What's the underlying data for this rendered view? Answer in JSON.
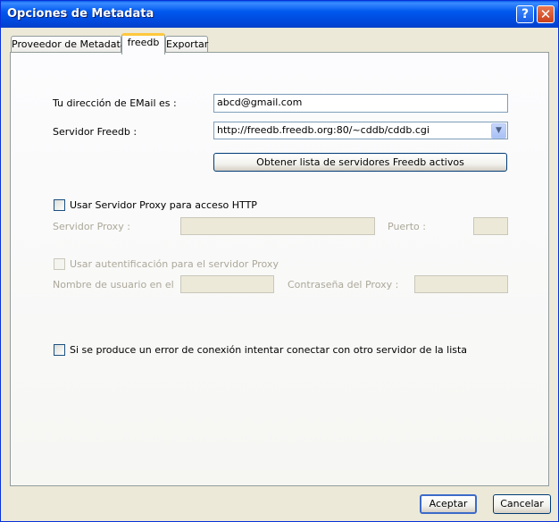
{
  "window": {
    "title": "Opciones de Metadata"
  },
  "titlebar": {
    "help_glyph": "?",
    "close_glyph": "✕"
  },
  "tabs": [
    {
      "label": "Proveedor de Metadata"
    },
    {
      "label": "freedb"
    },
    {
      "label": "Exportar"
    }
  ],
  "form": {
    "email_label": "Tu dirección de EMail es :",
    "email_value": "abcd@gmail.com",
    "server_label": "Servidor Freedb :",
    "server_value": "http://freedb.freedb.org:80/~cddb/cddb.cgi",
    "get_servers_button": "Obtener lista de servidores Freedb activos",
    "use_proxy_label": "Usar Servidor Proxy para acceso HTTP",
    "proxy_server_label": "Servidor Proxy :",
    "proxy_server_value": "",
    "port_label": "Puerto :",
    "port_value": "",
    "proxy_auth_label": "Usar autentificación para el servidor Proxy",
    "username_label": "Nombre de usuario en el",
    "username_value": "",
    "password_label": "Contraseña del Proxy :",
    "password_value": "",
    "retry_label": "Si se produce un error de conexión intentar conectar con otro servidor de la lista"
  },
  "footer": {
    "ok_label": "Aceptar",
    "cancel_label": "Cancelar"
  }
}
